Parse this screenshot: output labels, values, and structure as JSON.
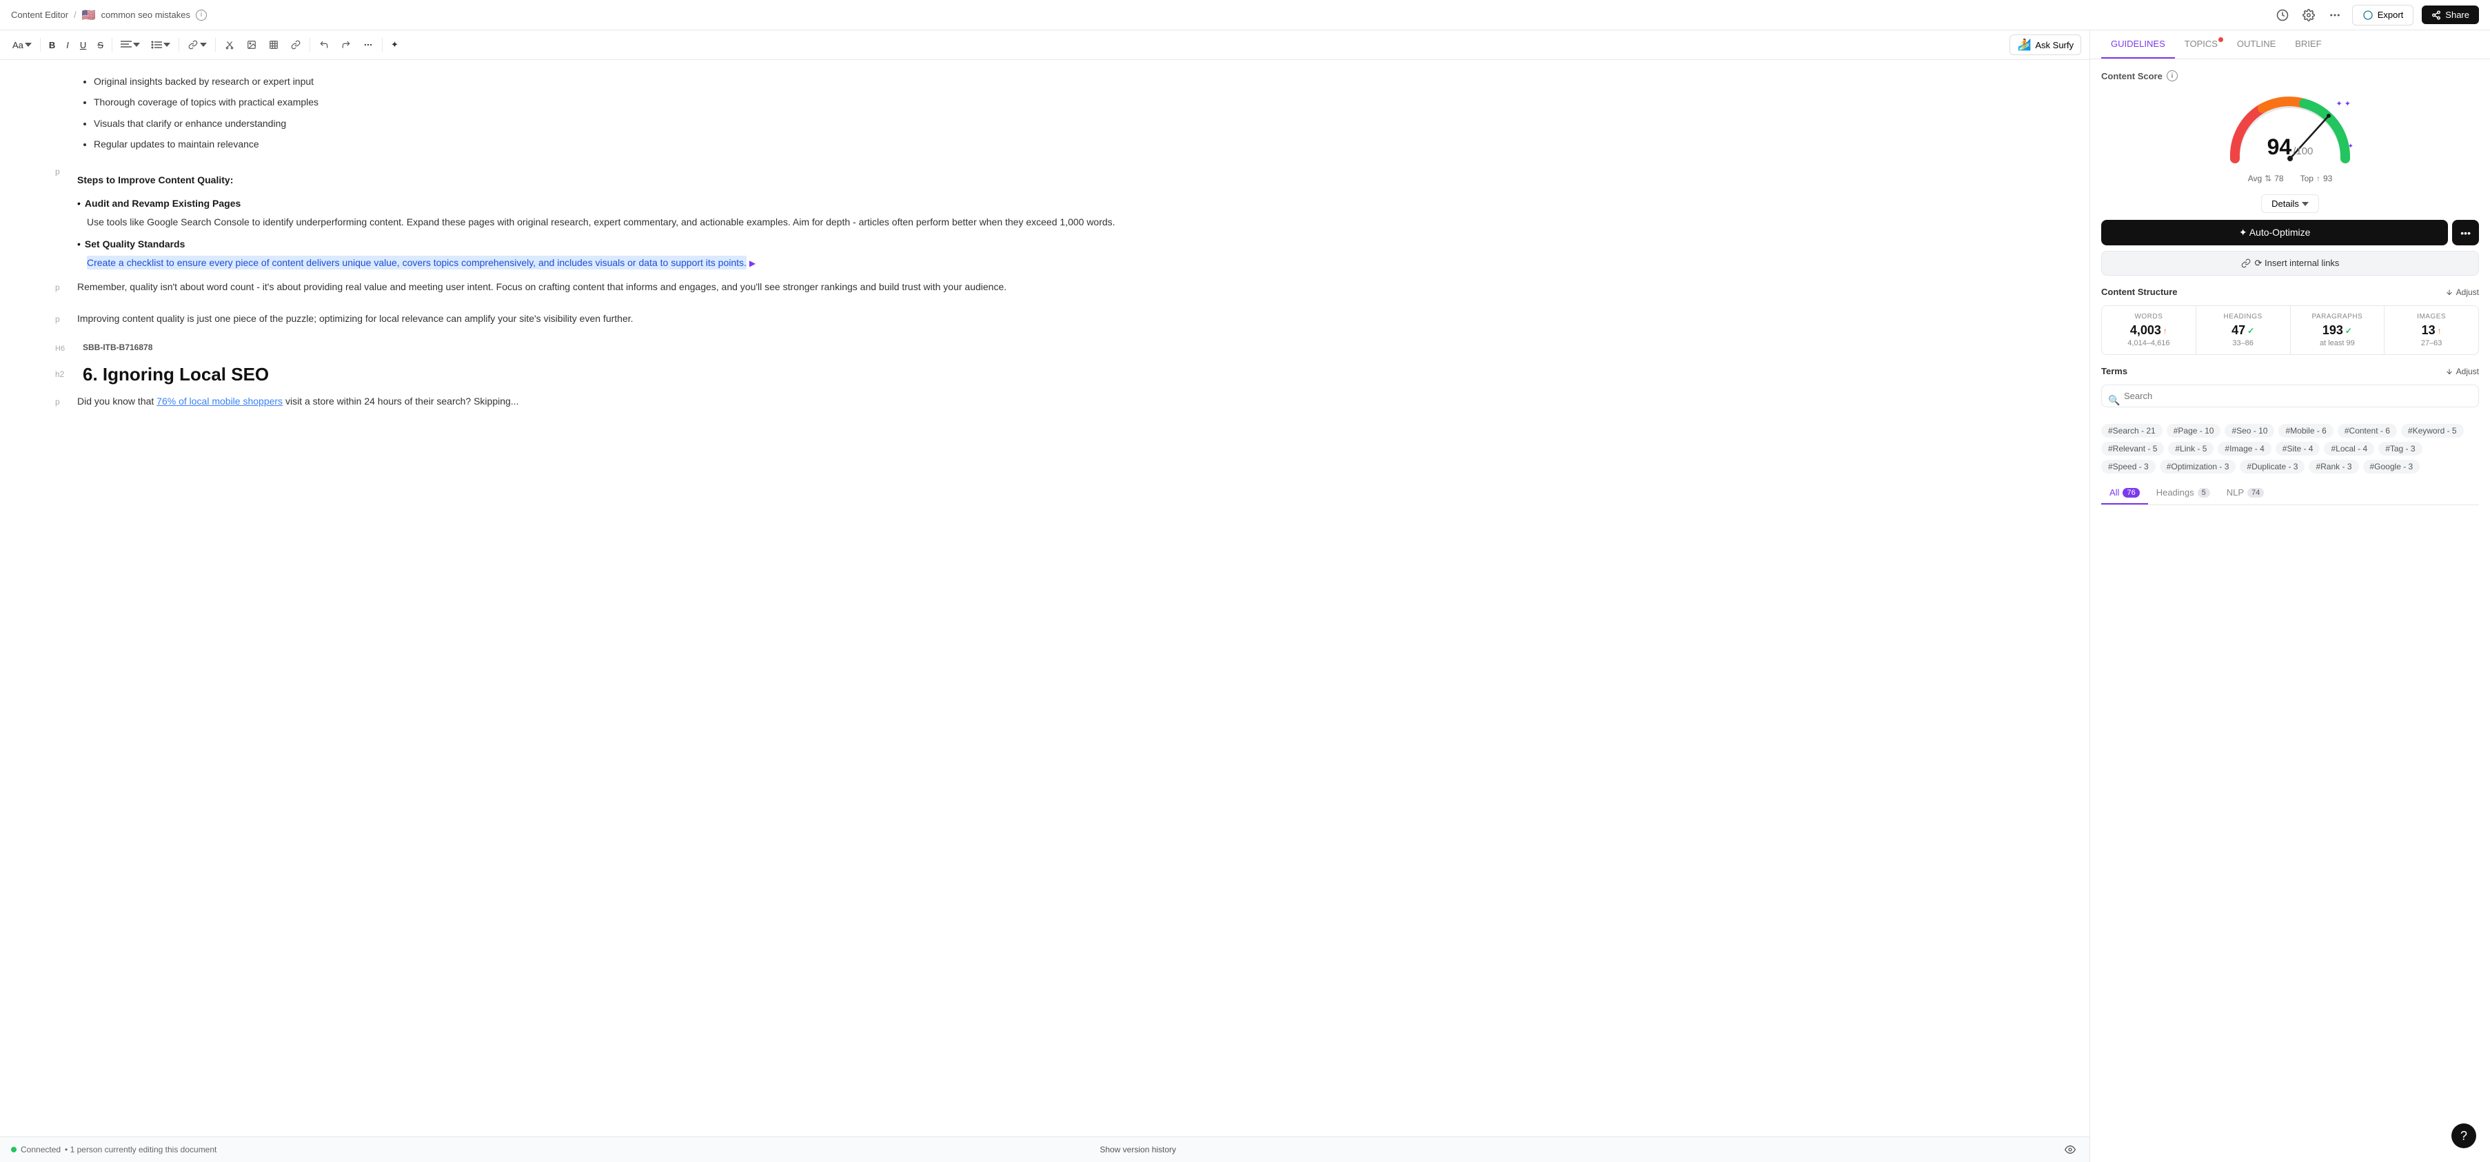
{
  "topbar": {
    "app_name": "Content Editor",
    "separator": "/",
    "breadcrumb_flag": "🇺🇸",
    "breadcrumb_page": "common seo mistakes",
    "wp_button": "Export",
    "share_button": "Share"
  },
  "toolbar": {
    "font_size": "Aa",
    "bold": "B",
    "italic": "I",
    "underline": "U",
    "strikethrough": "S",
    "align": "≡",
    "list": "☰",
    "link": "🔗",
    "image": "🖼",
    "table": "⊞",
    "hyperlink": "🔗",
    "undo": "↩",
    "redo": "↪",
    "more": "•••",
    "sparkle": "✦",
    "ask_surfy": "Ask Surfy"
  },
  "editor": {
    "bullets": [
      "Original insights backed by research or expert input",
      "Thorough coverage of topics with practical examples",
      "Visuals that clarify or enhance understanding",
      "Regular updates to maintain relevance"
    ],
    "section_heading": "Steps to Improve Content Quality:",
    "sub_item1_title": "Audit and Revamp Existing Pages",
    "sub_item1_text": "Use tools like Google Search Console to identify underperforming content. Expand these pages with original research, expert commentary, and actionable examples. Aim for depth - articles often perform better when they exceed 1,000 words.",
    "sub_item2_title": "Set Quality Standards",
    "sub_item2_text_highlighted": "Create a checklist to ensure every piece of content delivers unique value, covers topics comprehensively, and includes visuals or data to support its points.",
    "para1": "Remember, quality isn't about word count - it's about providing real value and meeting user intent. Focus on crafting content that informs and engages, and you'll see stronger rankings and build trust with your audience.",
    "para2": "Improving content quality is just one piece of the puzzle; optimizing for local relevance can amplify your site's visibility even further.",
    "h6_label": "H6",
    "h6_id": "SBB-ITB-B716878",
    "h2_label": "h2",
    "h2_heading": "6. Ignoring Local SEO",
    "para3_start": "Did you know that ",
    "para3_link": "76% of local mobile shoppers",
    "para3_end": " visit a store within 24 hours of their search? Skipping...",
    "status_connected": "Connected",
    "status_editing": "• 1 person currently editing this document",
    "version_history": "Show version history"
  },
  "panel": {
    "tabs": [
      {
        "id": "guidelines",
        "label": "GUIDELINES",
        "active": true,
        "dot": false
      },
      {
        "id": "topics",
        "label": "TOPICS",
        "active": false,
        "dot": true
      },
      {
        "id": "outline",
        "label": "OUTLINE",
        "active": false,
        "dot": false
      },
      {
        "id": "brief",
        "label": "BRIEF",
        "active": false,
        "dot": false
      }
    ],
    "content_score_label": "Content Score",
    "score_value": "94",
    "score_max": "/100",
    "score_avg_label": "Avg",
    "score_avg": "78",
    "score_top_label": "Top",
    "score_top": "93",
    "details_btn": "Details",
    "auto_optimize_btn": "✦ Auto-Optimize",
    "auto_optimize_more": "•••",
    "insert_links_btn": "⟳ Insert internal links",
    "content_structure_label": "Content Structure",
    "adjust_label": "Adjust",
    "structure": {
      "words": {
        "label": "WORDS",
        "value": "4,003",
        "arrow": "↑",
        "range": "4,014–4,616"
      },
      "headings": {
        "label": "HEADINGS",
        "value": "47",
        "check": "✓",
        "range": "33–86"
      },
      "paragraphs": {
        "label": "PARAGRAPHS",
        "value": "193",
        "check": "✓",
        "range": "at least 99"
      },
      "images": {
        "label": "IMAGES",
        "value": "13",
        "arrow": "↑",
        "range": "27–63"
      }
    },
    "terms_label": "Terms",
    "terms_adjust": "Adjust",
    "search_placeholder": "Search",
    "terms_tags": [
      "#Search - 21",
      "#Page - 10",
      "#Seo - 10",
      "#Mobile - 6",
      "#Content - 6",
      "#Keyword - 5",
      "#Relevant - 5",
      "#Link - 5",
      "#Image - 4",
      "#Site - 4",
      "#Local - 4",
      "#Tag - 3",
      "#Speed - 3",
      "#Optimization - 3",
      "#Duplicate - 3",
      "#Rank - 3",
      "#Google - 3"
    ],
    "term_tabs": [
      {
        "label": "All",
        "count": "76",
        "active": true
      },
      {
        "label": "Headings",
        "count": "5",
        "active": false
      },
      {
        "label": "NLP",
        "count": "74",
        "active": false
      }
    ]
  }
}
